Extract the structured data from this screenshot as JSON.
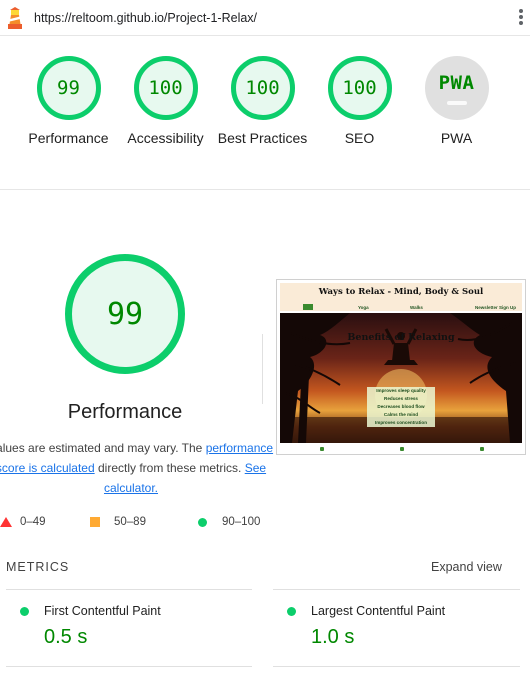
{
  "url": "https://reltoom.github.io/Project-1-Relax/",
  "colors": {
    "pass": "#0cce6b",
    "pass_text": "#008800",
    "average": "#ffaa33",
    "fail": "#ff3333",
    "na": "#e0e0e0"
  },
  "icons": {
    "logo": "lighthouse-icon",
    "menu": "more-vert-icon"
  },
  "categories": [
    {
      "score": "99",
      "label": "Performance"
    },
    {
      "score": "100",
      "label": "Accessibility"
    },
    {
      "score": "100",
      "label": "Best Practices"
    },
    {
      "score": "100",
      "label": "SEO"
    },
    {
      "badge": "PWA",
      "label": "PWA"
    }
  ],
  "performance": {
    "score": "99",
    "title": "Performance",
    "note_before": "Values are estimated and may vary. The",
    "note_link": "performance score is calculated",
    "note_after": "directly from these metrics.",
    "calculator_link": "See calculator."
  },
  "legend": {
    "fail": "0–49",
    "average": "50–89",
    "pass": "90–100"
  },
  "screenshot": {
    "site_title": "Ways to Relax - Mind, Body & Soul",
    "nav": [
      "Yoga",
      "Walks",
      "Newsletter Sign Up"
    ],
    "heading": "Benefits of Relaxing",
    "benefits": [
      "Improves sleep quality",
      "Reduces stress",
      "Decreases blood flow",
      "Calms the mind",
      "Improves concentration"
    ]
  },
  "metrics": {
    "title": "METRICS",
    "expand_label": "Expand view",
    "items": [
      {
        "label": "First Contentful Paint",
        "value": "0.5 s"
      },
      {
        "label": "Largest Contentful Paint",
        "value": "1.0 s"
      }
    ]
  }
}
